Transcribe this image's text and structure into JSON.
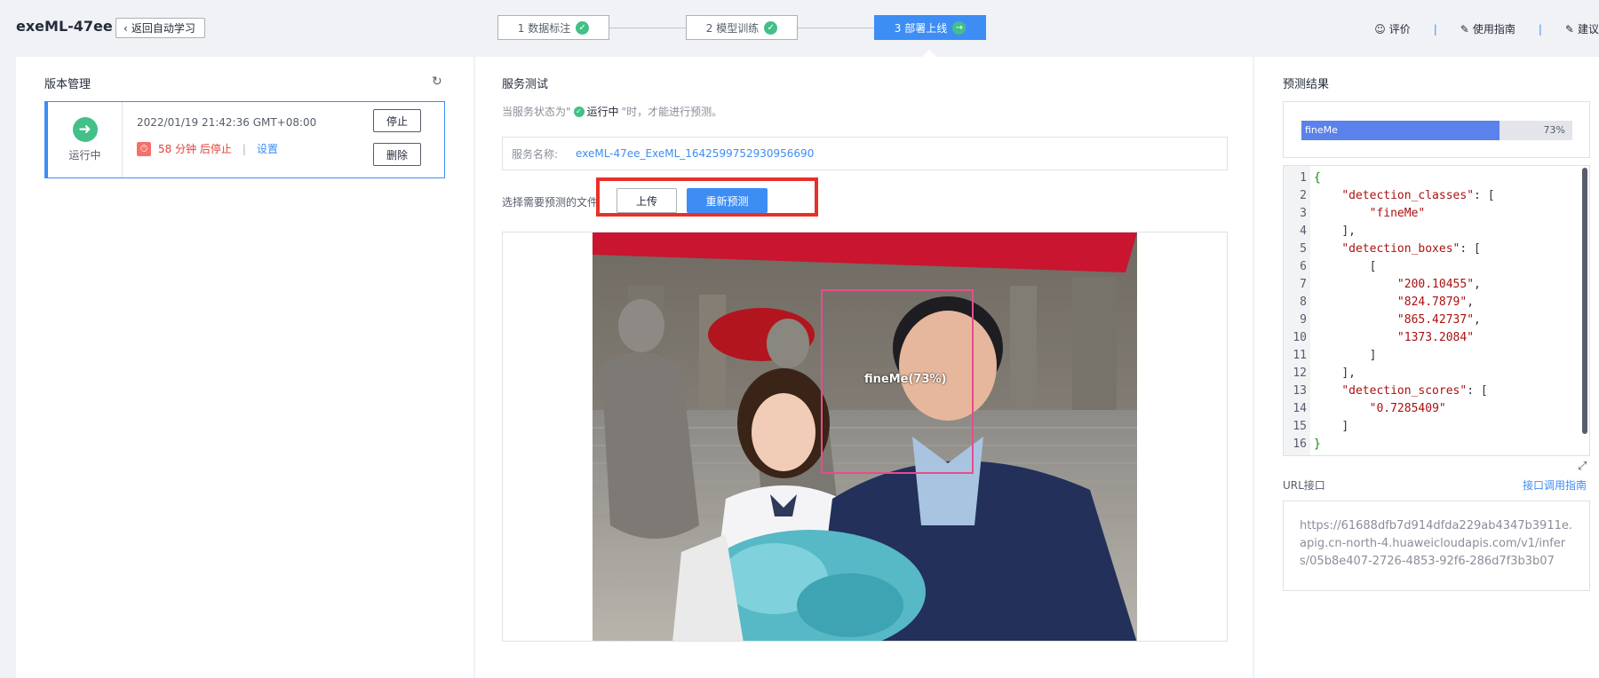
{
  "header": {
    "app_title": "exeML-47ee",
    "back_label": "返回自动学习",
    "steps": [
      {
        "label": "1 数据标注",
        "done": true
      },
      {
        "label": "2 模型训练",
        "done": true
      },
      {
        "label": "3 部署上线",
        "active": true
      }
    ],
    "links": {
      "rate": "评价",
      "guide": "使用指南",
      "suggest": "建议"
    }
  },
  "version": {
    "title": "版本管理",
    "status": "运行中",
    "time": "2022/01/19 21:42:36 GMT+08:00",
    "stop_countdown": "58 分钟 后停止",
    "settings": "设置",
    "stop_btn": "停止",
    "delete_btn": "删除"
  },
  "test": {
    "title": "服务测试",
    "hint_prefix": "当服务状态为\"",
    "hint_status": "运行中",
    "hint_suffix": "\"时，才能进行预测。",
    "service_label": "服务名称:",
    "service_name": "exeML-47ee_ExeML_1642599752930956690",
    "file_label": "选择需要预测的文件",
    "upload_btn": "上传",
    "redo_btn": "重新预测",
    "detection_label": "fineMe(73%)"
  },
  "result": {
    "title": "预测结果",
    "bar_label": "fineMe",
    "bar_pct_text": "73%",
    "bar_fraction": 0.73,
    "code_lines": [
      "{",
      "    \"detection_classes\": [",
      "        \"fineMe\"",
      "    ],",
      "    \"detection_boxes\": [",
      "        [",
      "            \"200.10455\",",
      "            \"824.7879\",",
      "            \"865.42737\",",
      "            \"1373.2084\"",
      "        ]",
      "    ],",
      "    \"detection_scores\": [",
      "        \"0.7285409\"",
      "    ]",
      "}"
    ],
    "url_label": "URL接口",
    "api_guide": "接口调用指南",
    "url": "https://61688dfb7d914dfda229ab4347b3911e.apig.cn-north-4.huaweicloudapis.com/v1/infers/05b8e407-2726-4853-92f6-286d7f3b3b07"
  },
  "colors": {
    "accent": "#3d8df5",
    "success": "#42c087",
    "danger": "#e5403b",
    "highlight_frame": "#e8302a",
    "detection_box": "#e84c8b"
  }
}
